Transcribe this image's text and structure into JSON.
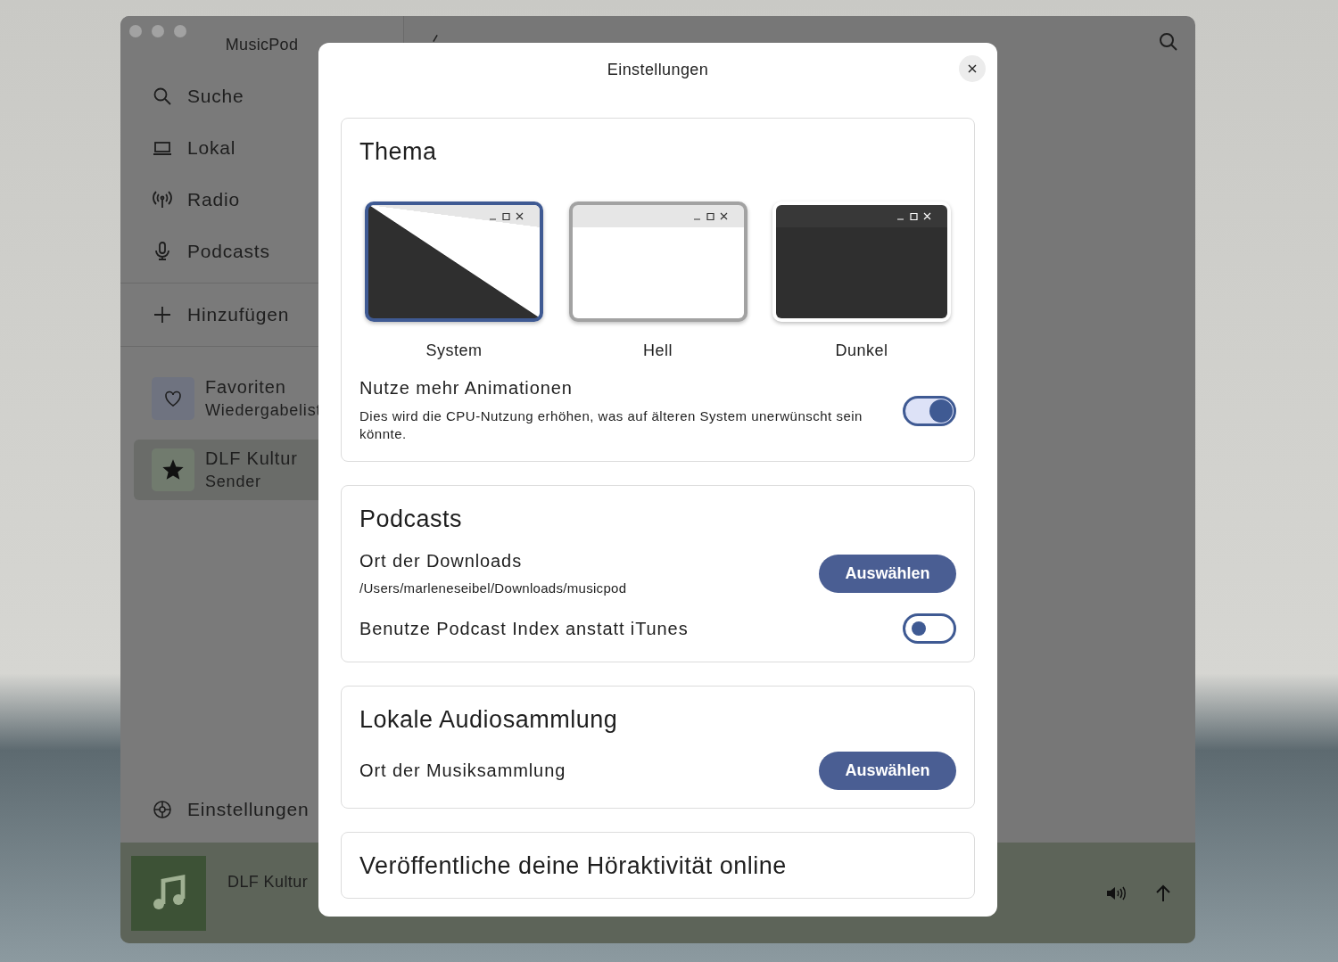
{
  "window": {
    "title": "MusicPod"
  },
  "sidebar": {
    "nav": [
      {
        "kind": "search",
        "label": "Suche"
      },
      {
        "kind": "local",
        "label": "Lokal"
      },
      {
        "kind": "radio",
        "label": "Radio"
      },
      {
        "kind": "podcasts",
        "label": "Podcasts"
      }
    ],
    "add": {
      "label": "Hinzufügen"
    },
    "library": [
      {
        "kind": "favorites",
        "title": "Favoriten",
        "subtitle": "Wiedergabelist",
        "selected": false
      },
      {
        "kind": "station",
        "title": "DLF Kultur",
        "subtitle": "Sender",
        "selected": true
      }
    ],
    "settings": {
      "label": "Einstellungen"
    }
  },
  "player": {
    "title": "DLF Kultur"
  },
  "dialog": {
    "title": "Einstellungen",
    "sections": [
      {
        "title": "Thema",
        "items": [
          {
            "kind": "themes",
            "options": [
              {
                "kind": "system",
                "label": "System",
                "selected": true
              },
              {
                "kind": "light",
                "label": "Hell",
                "selected": false
              },
              {
                "kind": "dark",
                "label": "Dunkel",
                "selected": false
              }
            ]
          },
          {
            "kind": "toggle",
            "label": "Nutze mehr Animationen",
            "description": "Dies wird die CPU-Nutzung erhöhen, was auf älteren System unerwünscht sein könnte.",
            "on": true
          }
        ]
      },
      {
        "title": "Podcasts",
        "items": [
          {
            "kind": "folder",
            "label": "Ort der Downloads",
            "path": "/Users/marleneseibel/Downloads/musicpod",
            "button": "Auswählen"
          },
          {
            "kind": "toggle",
            "label": "Benutze Podcast Index anstatt iTunes",
            "on": false
          }
        ]
      },
      {
        "title": "Lokale Audiosammlung",
        "items": [
          {
            "kind": "folder",
            "label": "Ort der Musiksammlung",
            "button": "Auswählen"
          }
        ]
      },
      {
        "title": "Veröffentliche deine Höraktivität online"
      }
    ]
  }
}
